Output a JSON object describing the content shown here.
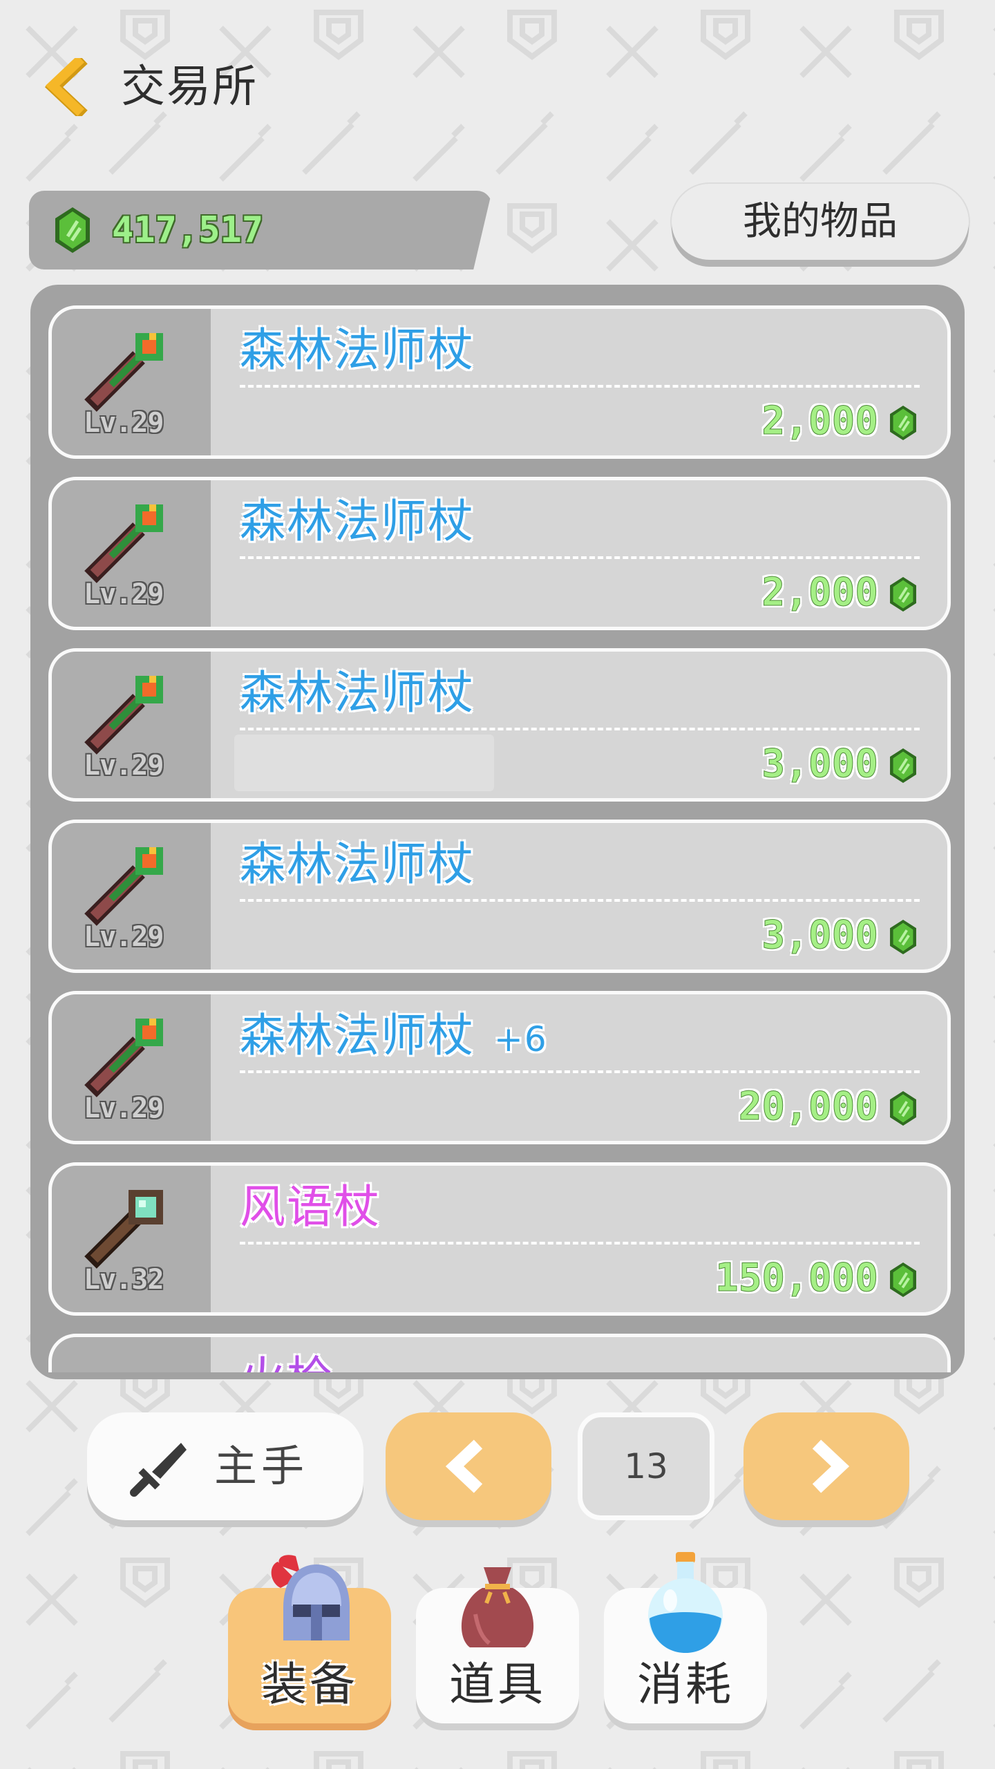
{
  "header": {
    "title": "交易所",
    "back_icon": "chevron-left-icon"
  },
  "currency": {
    "amount": "417,517",
    "icon": "green-gem-icon"
  },
  "my_items_label": "我的物品",
  "colors": {
    "accent": "#f5b728",
    "gem_green": "#5bbf3a",
    "name_blue": "#2f9fe6",
    "name_pink": "#e04fe8",
    "name_purple": "#b34fe8",
    "price_green": "#a5ef86"
  },
  "listings": [
    {
      "name": "森林法师杖",
      "level": "Lv.29",
      "price": "2,000",
      "color": "blue",
      "icon": "staff-icon"
    },
    {
      "name": "森林法师杖",
      "level": "Lv.29",
      "price": "2,000",
      "color": "blue",
      "icon": "staff-icon"
    },
    {
      "name": "森林法师杖",
      "level": "Lv.29",
      "price": "3,000",
      "color": "blue",
      "icon": "staff-icon"
    },
    {
      "name": "森林法师杖",
      "level": "Lv.29",
      "price": "3,000",
      "color": "blue",
      "icon": "staff-icon"
    },
    {
      "name": "森林法师杖",
      "enhance": "+6",
      "level": "Lv.29",
      "price": "20,000",
      "color": "blue",
      "icon": "staff-icon"
    },
    {
      "name": "风语杖",
      "level": "Lv.32",
      "price": "150,000",
      "color": "pink",
      "icon": "orb-staff-icon"
    },
    {
      "name": "火枪",
      "color": "purple"
    }
  ],
  "filter": {
    "slot_label": "主手",
    "icon": "sword-icon"
  },
  "pagination": {
    "page": "13",
    "prev_icon": "chevron-left-icon",
    "next_icon": "chevron-right-icon"
  },
  "tabs": [
    {
      "label": "装备",
      "icon": "helmet-icon",
      "active": true
    },
    {
      "label": "道具",
      "icon": "bag-icon",
      "active": false
    },
    {
      "label": "消耗",
      "icon": "potion-icon",
      "active": false
    }
  ]
}
